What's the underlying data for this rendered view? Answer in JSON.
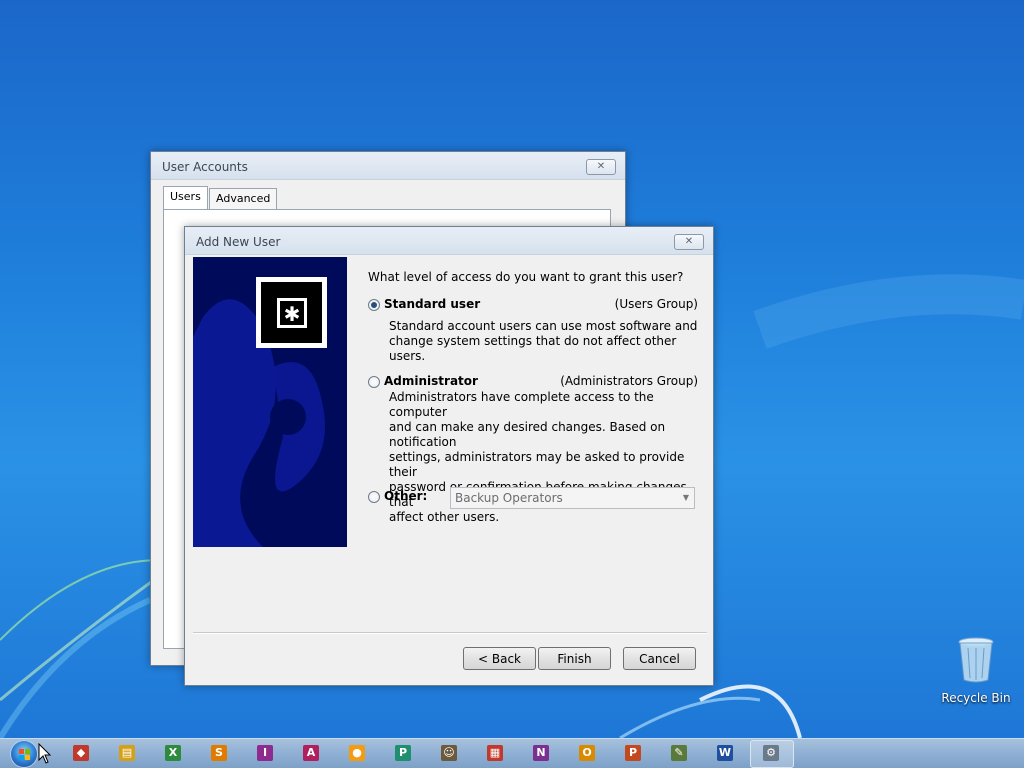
{
  "user_accounts": {
    "title": "User Accounts",
    "tabs": [
      {
        "label": "Users",
        "active": true
      },
      {
        "label": "Advanced",
        "active": false
      }
    ]
  },
  "add_new_user": {
    "title": "Add New User",
    "question": "What level of access do you want to grant this user?",
    "options": [
      {
        "label": "Standard user",
        "group": "(Users Group)",
        "checked": true,
        "description": [
          "Standard account users can use most software and",
          "change system settings that do not affect other users."
        ]
      },
      {
        "label": "Administrator",
        "group": "(Administrators Group)",
        "checked": false,
        "description": [
          "Administrators have complete access to the computer",
          "and can make any desired changes. Based on notification",
          "settings, administrators may be asked to provide their",
          "password or confirmation before making changes that",
          "affect other users."
        ]
      },
      {
        "label": "Other:",
        "checked": false,
        "select_value": "Backup Operators"
      }
    ],
    "buttons": {
      "back": "< Back",
      "finish": "Finish",
      "cancel": "Cancel"
    }
  },
  "desktop": {
    "recycle_bin_label": "Recycle Bin"
  },
  "taskbar": {
    "icons": [
      {
        "name": "gimp-icon",
        "glyph": "◆",
        "color": "#c0392b"
      },
      {
        "name": "file-explorer-icon",
        "glyph": "▤",
        "color": "#d4a017"
      },
      {
        "name": "excel-icon",
        "glyph": "X",
        "color": "#2e8b3d"
      },
      {
        "name": "sheets-icon",
        "glyph": "S",
        "color": "#e07b00"
      },
      {
        "name": "infopath-icon",
        "glyph": "I",
        "color": "#8e2b8e"
      },
      {
        "name": "access-icon",
        "glyph": "A",
        "color": "#b0205e"
      },
      {
        "name": "orange-app-icon",
        "glyph": "●",
        "color": "#f39c12"
      },
      {
        "name": "publisher-icon",
        "glyph": "P",
        "color": "#1f8f6f"
      },
      {
        "name": "contacts-icon",
        "glyph": "☺",
        "color": "#6b5a3c"
      },
      {
        "name": "chart-app-icon",
        "glyph": "▦",
        "color": "#c0392b"
      },
      {
        "name": "onenote-icon",
        "glyph": "N",
        "color": "#7b2f8e"
      },
      {
        "name": "outlook-icon",
        "glyph": "O",
        "color": "#d88a00"
      },
      {
        "name": "powerpoint-icon",
        "glyph": "P",
        "color": "#c4481d"
      },
      {
        "name": "paint-icon",
        "glyph": "✎",
        "color": "#5a7a3c"
      },
      {
        "name": "word-icon",
        "glyph": "W",
        "color": "#1f4e9e"
      },
      {
        "name": "user-accounts-icon",
        "glyph": "⚙",
        "color": "#6b7a8a"
      }
    ]
  }
}
